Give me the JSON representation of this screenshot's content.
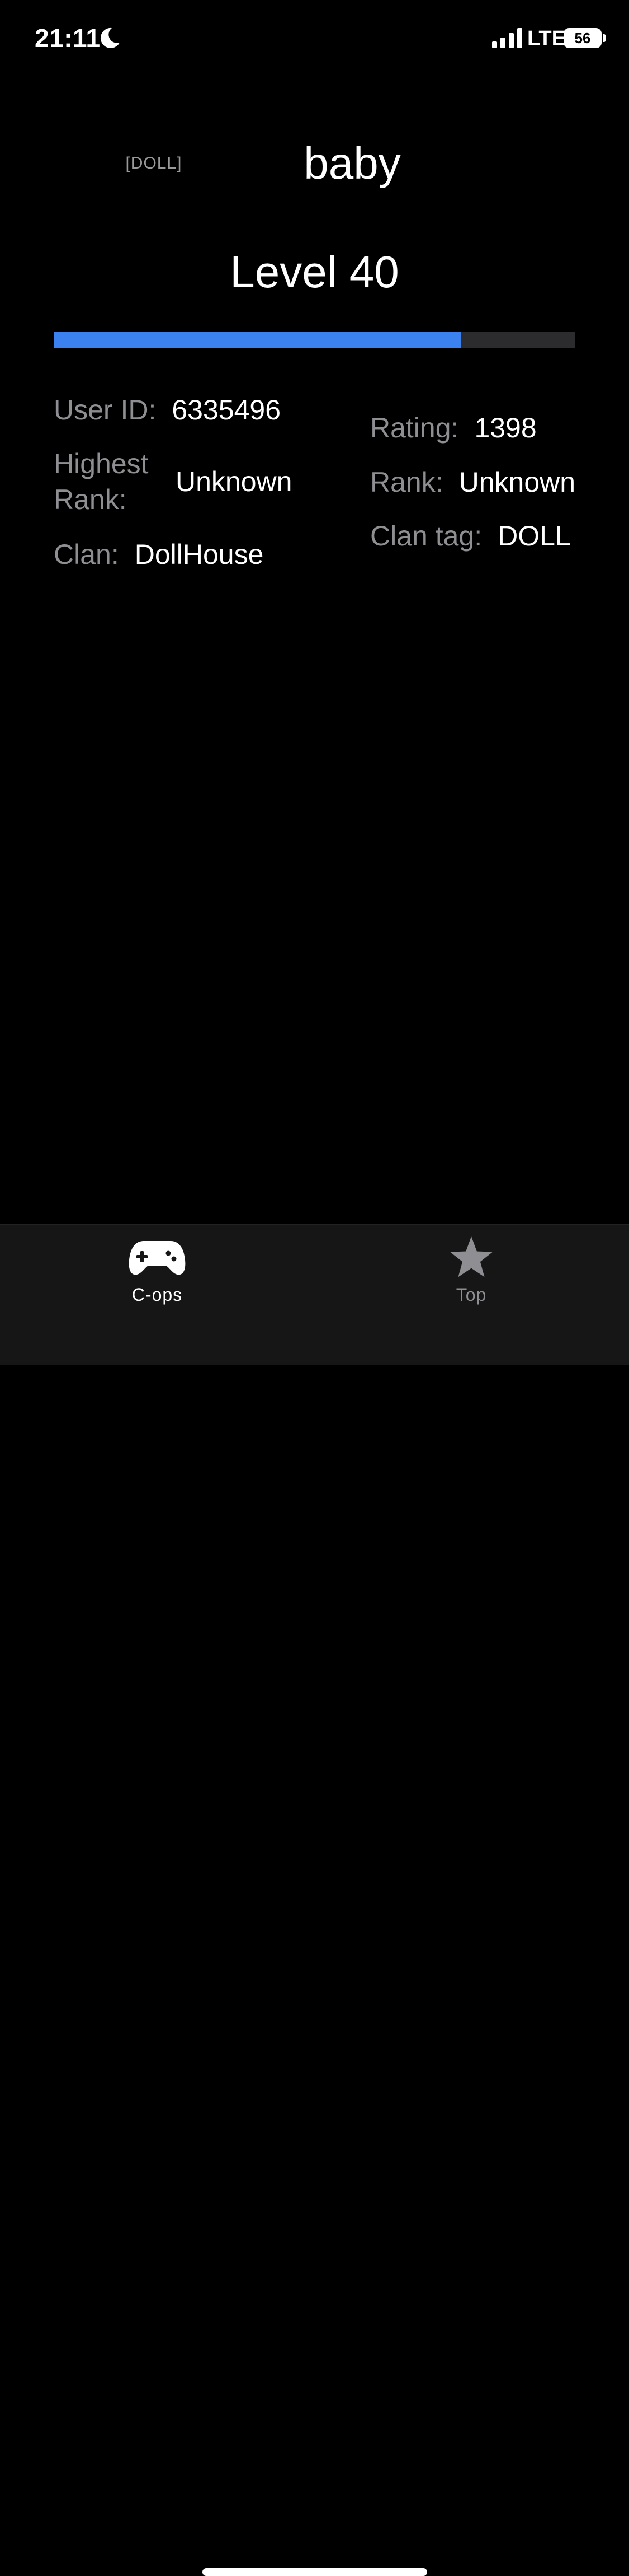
{
  "status_bar": {
    "time": "21:11",
    "network": "LTE",
    "battery": "56"
  },
  "profile": {
    "clan_prefix": "[DOLL]",
    "username": "baby",
    "level_title": "Level 40",
    "level_progress": 0.78
  },
  "stats": {
    "user_id": {
      "label": "User ID:",
      "value": "6335496"
    },
    "highest_rank": {
      "label_line1": "Highest",
      "label_line2": "Rank:",
      "value": "Unknown"
    },
    "clan": {
      "label": "Clan:",
      "value": "DollHouse"
    },
    "rating": {
      "label": "Rating:",
      "value": "1398"
    },
    "rank": {
      "label": "Rank:",
      "value": "Unknown"
    },
    "clan_tag": {
      "label": "Clan tag:",
      "value": "DOLL"
    }
  },
  "tab_bar": {
    "tabs": [
      {
        "label": "C-ops",
        "icon": "gamepad-icon",
        "active": true
      },
      {
        "label": "Top",
        "icon": "star-icon",
        "active": false
      }
    ]
  },
  "colors": {
    "background": "#000000",
    "accent": "#3b82f0",
    "track": "#2c2c2e",
    "secondary_text": "#8e8e93"
  }
}
